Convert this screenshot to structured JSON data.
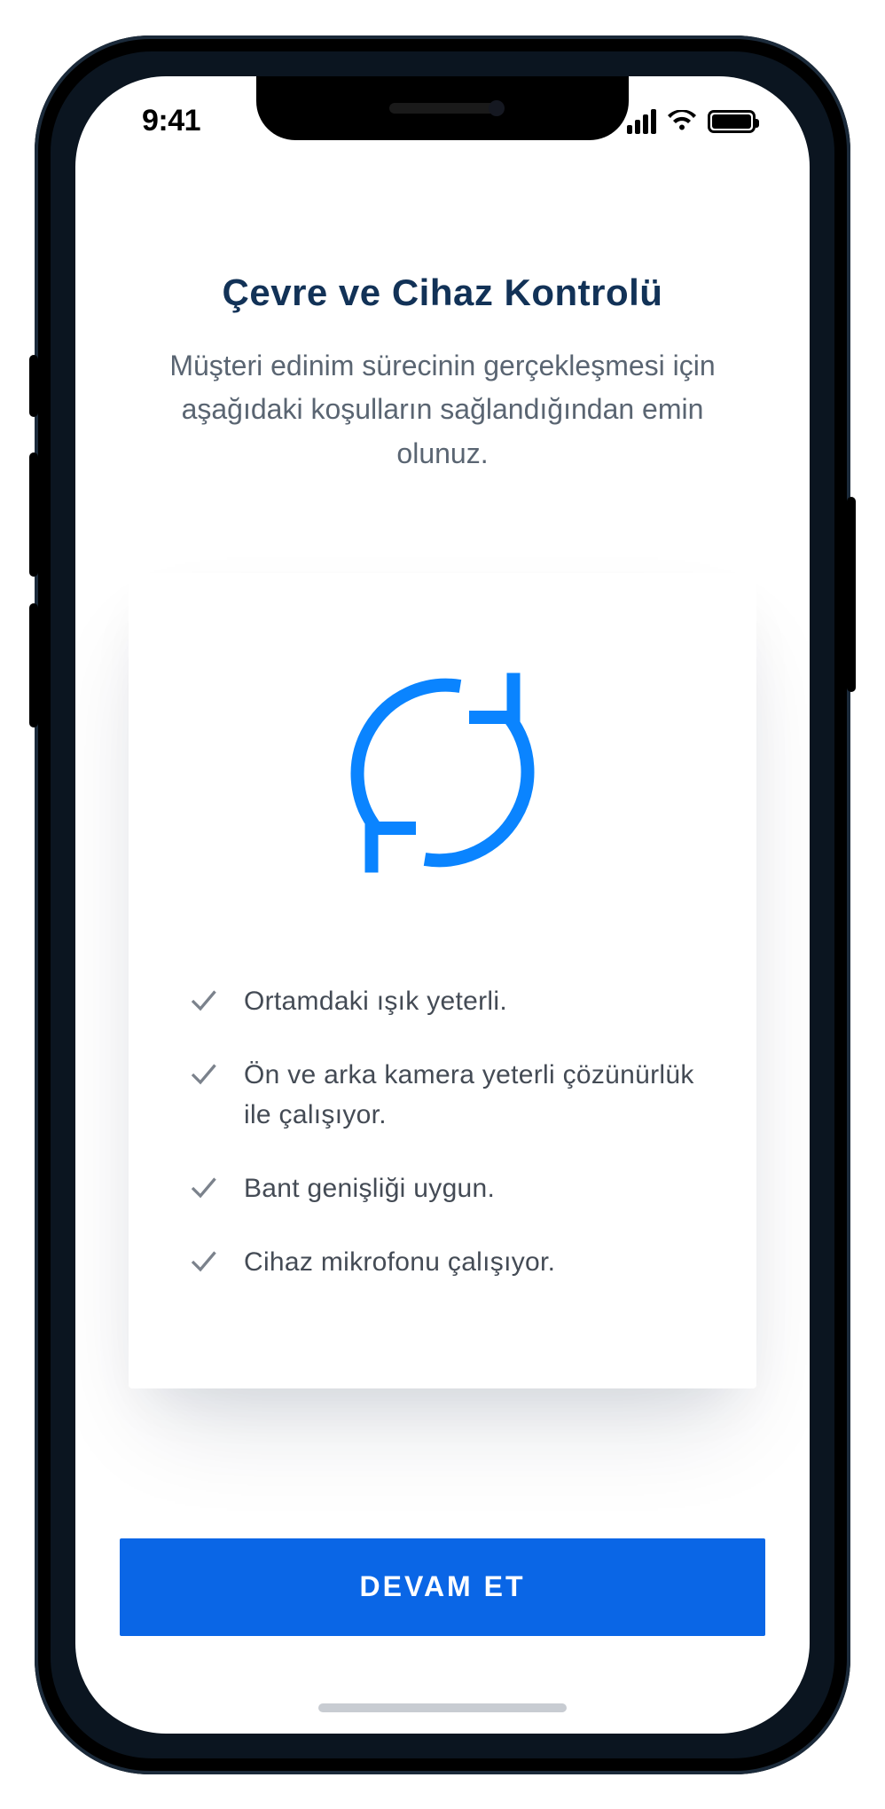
{
  "status": {
    "time": "9:41"
  },
  "header": {
    "title": "Çevre ve Cihaz Kontrolü",
    "subtitle": "Müşteri edinim sürecinin gerçekleşmesi için aşağıdaki koşulların sağlandığından emin olunuz."
  },
  "checks": [
    "Ortamdaki ışık yeterli.",
    "Ön ve arka kamera yeterli çözünürlük ile çalışıyor.",
    "Bant genişliği uygun.",
    "Cihaz mikrofonu çalışıyor."
  ],
  "cta_label": "DEVAM ET",
  "colors": {
    "primary": "#0a66e6",
    "title": "#123257",
    "body": "#5a6572"
  }
}
